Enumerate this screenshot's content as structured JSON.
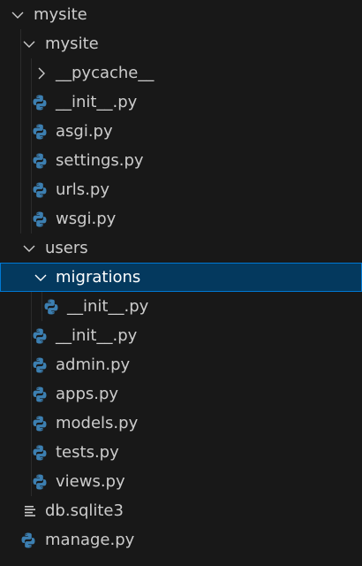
{
  "explorer": {
    "items": [
      {
        "label": "mysite",
        "kind": "folder",
        "expanded": true,
        "icon": "chevron-down-icon"
      },
      {
        "label": "mysite",
        "kind": "folder",
        "expanded": true,
        "icon": "chevron-down-icon"
      },
      {
        "label": "__pycache__",
        "kind": "folder",
        "expanded": false,
        "icon": "chevron-right-icon"
      },
      {
        "label": "__init__.py",
        "kind": "file",
        "icon": "python-icon"
      },
      {
        "label": "asgi.py",
        "kind": "file",
        "icon": "python-icon"
      },
      {
        "label": "settings.py",
        "kind": "file",
        "icon": "python-icon"
      },
      {
        "label": "urls.py",
        "kind": "file",
        "icon": "python-icon"
      },
      {
        "label": "wsgi.py",
        "kind": "file",
        "icon": "python-icon"
      },
      {
        "label": "users",
        "kind": "folder",
        "expanded": true,
        "icon": "chevron-down-icon"
      },
      {
        "label": "migrations",
        "kind": "folder",
        "expanded": true,
        "selected": true,
        "icon": "chevron-down-icon"
      },
      {
        "label": "__init__.py",
        "kind": "file",
        "icon": "python-icon"
      },
      {
        "label": "__init__.py",
        "kind": "file",
        "icon": "python-icon"
      },
      {
        "label": "admin.py",
        "kind": "file",
        "icon": "python-icon"
      },
      {
        "label": "apps.py",
        "kind": "file",
        "icon": "python-icon"
      },
      {
        "label": "models.py",
        "kind": "file",
        "icon": "python-icon"
      },
      {
        "label": "tests.py",
        "kind": "file",
        "icon": "python-icon"
      },
      {
        "label": "views.py",
        "kind": "file",
        "icon": "python-icon"
      },
      {
        "label": "db.sqlite3",
        "kind": "file",
        "icon": "database-file-icon"
      },
      {
        "label": "manage.py",
        "kind": "file",
        "icon": "python-icon"
      }
    ]
  },
  "colors": {
    "background": "#181818",
    "text": "#cccccc",
    "selection_background": "#04395e",
    "selection_border": "#0078d4",
    "python_blue": "#3c7fb1",
    "python_yellow": "#ffd43b"
  }
}
